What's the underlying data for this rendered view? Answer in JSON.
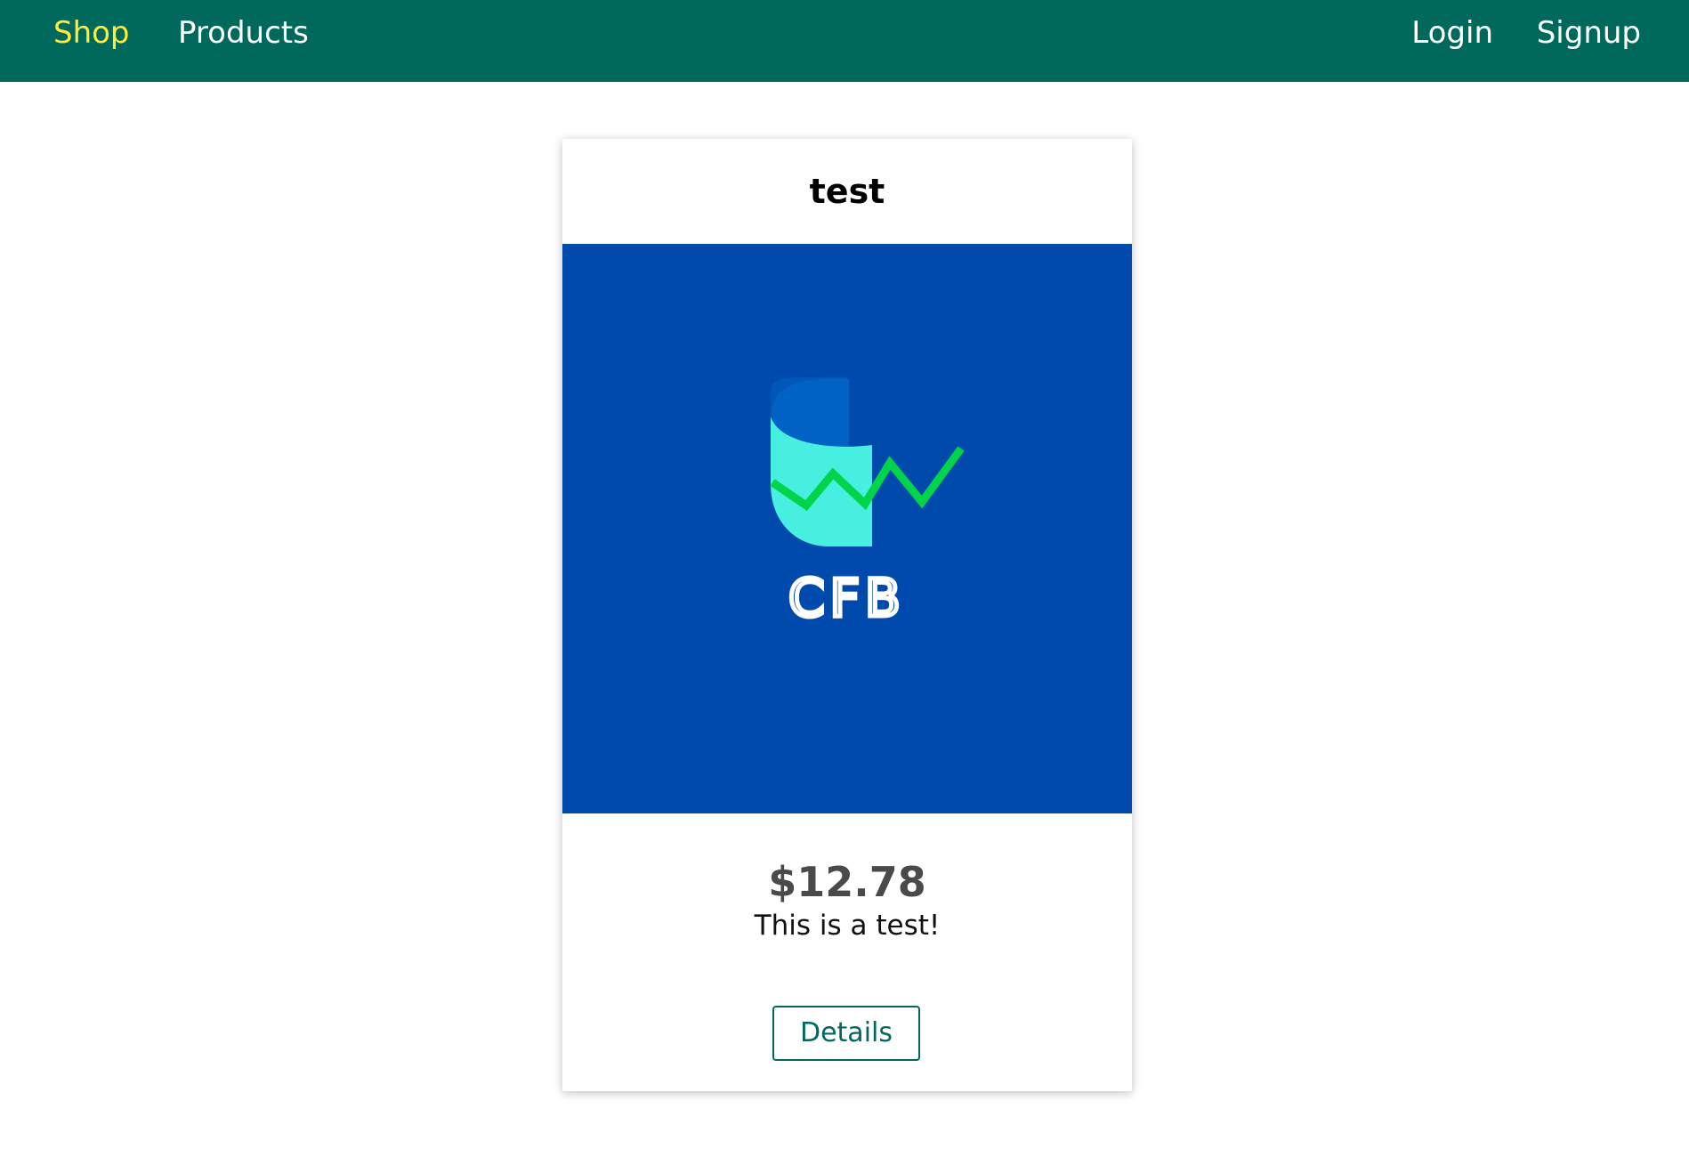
{
  "navbar": {
    "left_links": [
      {
        "label": "Shop",
        "active": true
      },
      {
        "label": "Products",
        "active": false
      }
    ],
    "right_links": [
      {
        "label": "Login"
      },
      {
        "label": "Signup"
      }
    ]
  },
  "product": {
    "title": "test",
    "image_logo_text": "CFB",
    "price": "$12.78",
    "description": "This is a test!",
    "details_label": "Details"
  },
  "colors": {
    "navbar_bg": "#00695c",
    "active_link": "#ffeb3b",
    "image_bg": "#004aad",
    "logo_teal": "#46efe0",
    "logo_green": "#00d44a",
    "logo_dark_blue": "#0057b8"
  }
}
